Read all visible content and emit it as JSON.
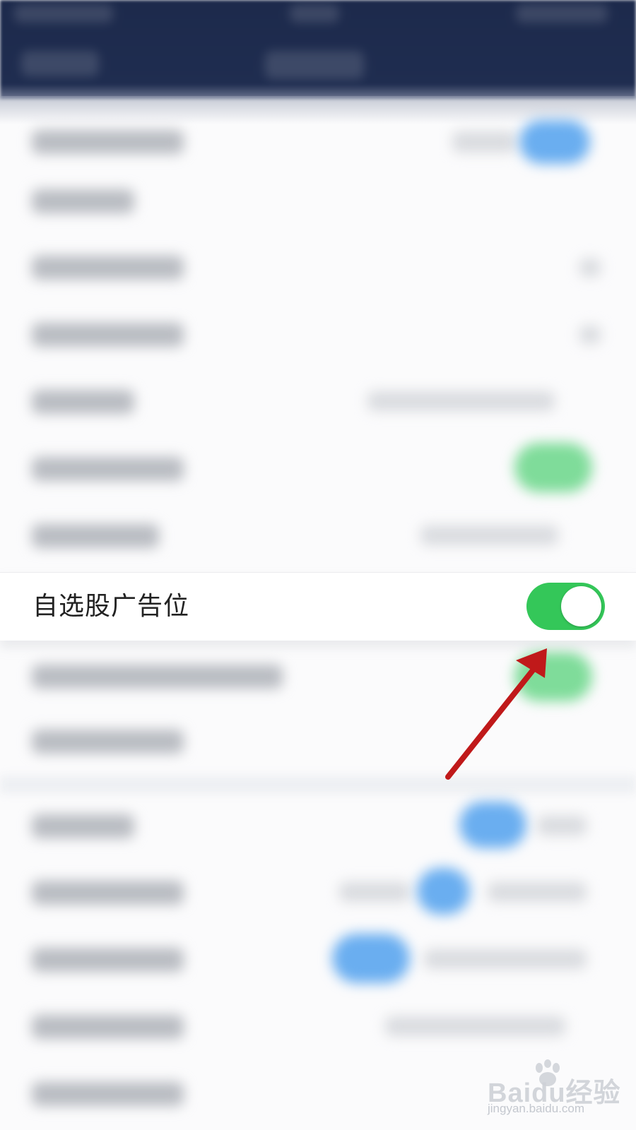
{
  "settings": {
    "focus_row": {
      "label": "自选股广告位",
      "toggle_on": true,
      "toggle_color": "#34c759"
    }
  },
  "annotation": {
    "arrow_color": "#c0191a"
  },
  "watermark": {
    "brand": "Baidu经验",
    "url": "jingyan.baidu.com"
  }
}
